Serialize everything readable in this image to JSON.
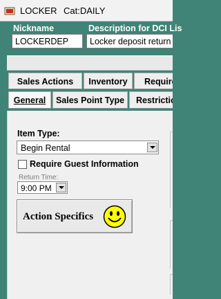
{
  "window": {
    "title": "LOCKER",
    "category": "Cat:DAILY",
    "icon": "ticket-icon"
  },
  "header": {
    "nickname_label": "Nickname",
    "nickname_value": "LOCKERDEP",
    "description_label": "Description for DCI Lis",
    "description_value": "Locker deposit return"
  },
  "tabs_row1": [
    {
      "label": "Sales Actions"
    },
    {
      "label": "Inventory"
    },
    {
      "label": "Require"
    }
  ],
  "tabs_row2": [
    {
      "label": "General",
      "active": true
    },
    {
      "label": "Sales Point Type"
    },
    {
      "label": "Restrictio"
    }
  ],
  "form": {
    "item_type_label": "Item Type:",
    "item_type_value": "Begin Rental",
    "require_guest_label": "Require Guest Information",
    "require_guest_checked": false,
    "return_time_label": "Return Time:",
    "return_time_value": "9:00 PM",
    "action_button_label": "Action Specifics",
    "action_button_icon": "smiley-icon"
  },
  "colors": {
    "background": "#3f8477",
    "panel": "#f0f0f0",
    "smiley": "#ffff00"
  }
}
